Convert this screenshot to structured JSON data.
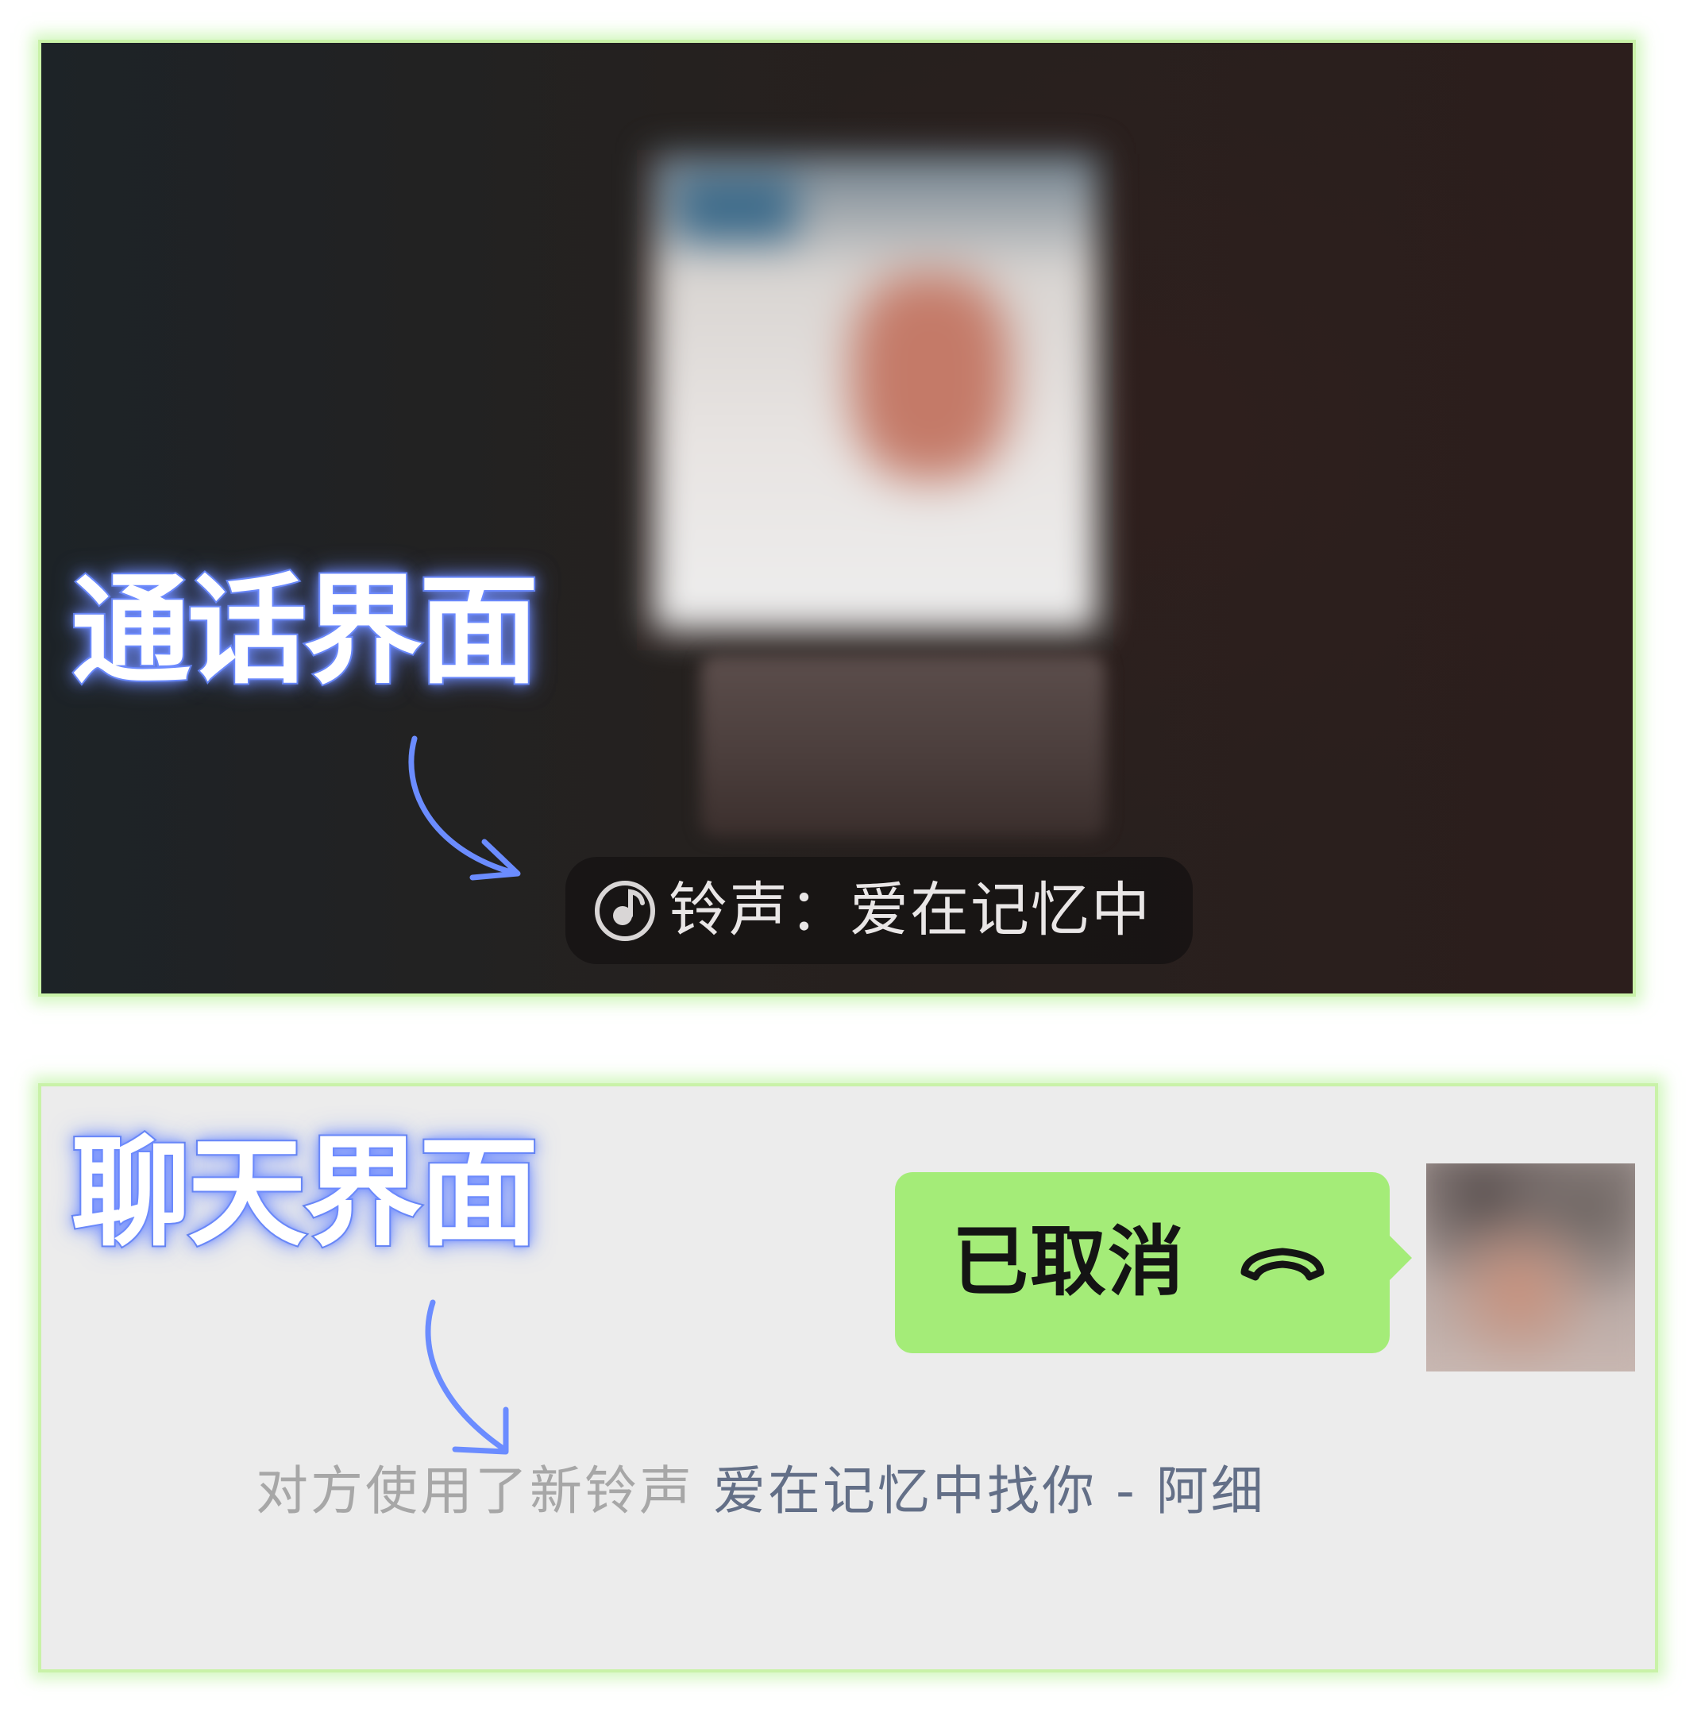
{
  "call_screen": {
    "annotation_label": "通话界面",
    "ringtone_text": "铃声：爱在记忆中",
    "icon": "music-note-icon"
  },
  "chat_screen": {
    "annotation_label": "聊天界面",
    "message_bubble": {
      "text": "已取消",
      "icon": "hang-up-phone-icon",
      "color": "#a4ec78"
    },
    "system_note": {
      "prefix": "对方使用了新铃声",
      "song": "爱在记忆中找你 - 阿细"
    }
  },
  "colors": {
    "panel_border": "#c9f2a8",
    "annotation_glow": "#6f8cff",
    "arrow": "#6b8cff",
    "chat_background": "#ececec"
  }
}
